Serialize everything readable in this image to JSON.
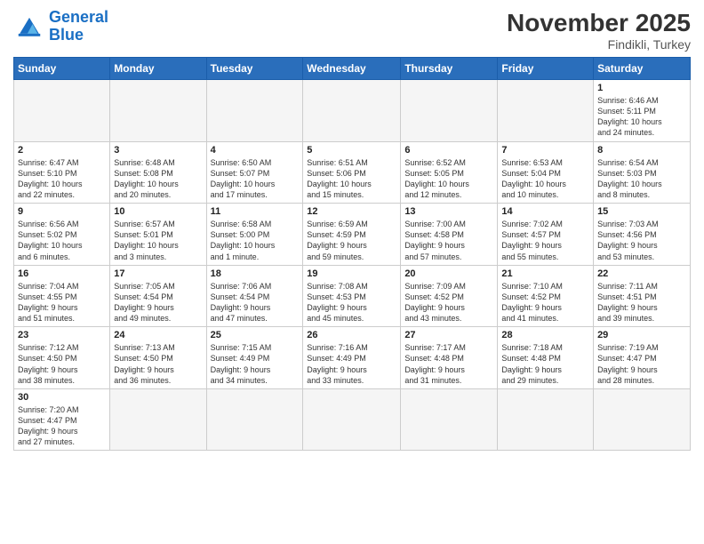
{
  "header": {
    "logo_general": "General",
    "logo_blue": "Blue",
    "month": "November 2025",
    "location": "Findikli, Turkey"
  },
  "days_of_week": [
    "Sunday",
    "Monday",
    "Tuesday",
    "Wednesday",
    "Thursday",
    "Friday",
    "Saturday"
  ],
  "weeks": [
    [
      {
        "num": "",
        "info": ""
      },
      {
        "num": "",
        "info": ""
      },
      {
        "num": "",
        "info": ""
      },
      {
        "num": "",
        "info": ""
      },
      {
        "num": "",
        "info": ""
      },
      {
        "num": "",
        "info": ""
      },
      {
        "num": "1",
        "info": "Sunrise: 6:46 AM\nSunset: 5:11 PM\nDaylight: 10 hours\nand 24 minutes."
      }
    ],
    [
      {
        "num": "2",
        "info": "Sunrise: 6:47 AM\nSunset: 5:10 PM\nDaylight: 10 hours\nand 22 minutes."
      },
      {
        "num": "3",
        "info": "Sunrise: 6:48 AM\nSunset: 5:08 PM\nDaylight: 10 hours\nand 20 minutes."
      },
      {
        "num": "4",
        "info": "Sunrise: 6:50 AM\nSunset: 5:07 PM\nDaylight: 10 hours\nand 17 minutes."
      },
      {
        "num": "5",
        "info": "Sunrise: 6:51 AM\nSunset: 5:06 PM\nDaylight: 10 hours\nand 15 minutes."
      },
      {
        "num": "6",
        "info": "Sunrise: 6:52 AM\nSunset: 5:05 PM\nDaylight: 10 hours\nand 12 minutes."
      },
      {
        "num": "7",
        "info": "Sunrise: 6:53 AM\nSunset: 5:04 PM\nDaylight: 10 hours\nand 10 minutes."
      },
      {
        "num": "8",
        "info": "Sunrise: 6:54 AM\nSunset: 5:03 PM\nDaylight: 10 hours\nand 8 minutes."
      }
    ],
    [
      {
        "num": "9",
        "info": "Sunrise: 6:56 AM\nSunset: 5:02 PM\nDaylight: 10 hours\nand 6 minutes."
      },
      {
        "num": "10",
        "info": "Sunrise: 6:57 AM\nSunset: 5:01 PM\nDaylight: 10 hours\nand 3 minutes."
      },
      {
        "num": "11",
        "info": "Sunrise: 6:58 AM\nSunset: 5:00 PM\nDaylight: 10 hours\nand 1 minute."
      },
      {
        "num": "12",
        "info": "Sunrise: 6:59 AM\nSunset: 4:59 PM\nDaylight: 9 hours\nand 59 minutes."
      },
      {
        "num": "13",
        "info": "Sunrise: 7:00 AM\nSunset: 4:58 PM\nDaylight: 9 hours\nand 57 minutes."
      },
      {
        "num": "14",
        "info": "Sunrise: 7:02 AM\nSunset: 4:57 PM\nDaylight: 9 hours\nand 55 minutes."
      },
      {
        "num": "15",
        "info": "Sunrise: 7:03 AM\nSunset: 4:56 PM\nDaylight: 9 hours\nand 53 minutes."
      }
    ],
    [
      {
        "num": "16",
        "info": "Sunrise: 7:04 AM\nSunset: 4:55 PM\nDaylight: 9 hours\nand 51 minutes."
      },
      {
        "num": "17",
        "info": "Sunrise: 7:05 AM\nSunset: 4:54 PM\nDaylight: 9 hours\nand 49 minutes."
      },
      {
        "num": "18",
        "info": "Sunrise: 7:06 AM\nSunset: 4:54 PM\nDaylight: 9 hours\nand 47 minutes."
      },
      {
        "num": "19",
        "info": "Sunrise: 7:08 AM\nSunset: 4:53 PM\nDaylight: 9 hours\nand 45 minutes."
      },
      {
        "num": "20",
        "info": "Sunrise: 7:09 AM\nSunset: 4:52 PM\nDaylight: 9 hours\nand 43 minutes."
      },
      {
        "num": "21",
        "info": "Sunrise: 7:10 AM\nSunset: 4:52 PM\nDaylight: 9 hours\nand 41 minutes."
      },
      {
        "num": "22",
        "info": "Sunrise: 7:11 AM\nSunset: 4:51 PM\nDaylight: 9 hours\nand 39 minutes."
      }
    ],
    [
      {
        "num": "23",
        "info": "Sunrise: 7:12 AM\nSunset: 4:50 PM\nDaylight: 9 hours\nand 38 minutes."
      },
      {
        "num": "24",
        "info": "Sunrise: 7:13 AM\nSunset: 4:50 PM\nDaylight: 9 hours\nand 36 minutes."
      },
      {
        "num": "25",
        "info": "Sunrise: 7:15 AM\nSunset: 4:49 PM\nDaylight: 9 hours\nand 34 minutes."
      },
      {
        "num": "26",
        "info": "Sunrise: 7:16 AM\nSunset: 4:49 PM\nDaylight: 9 hours\nand 33 minutes."
      },
      {
        "num": "27",
        "info": "Sunrise: 7:17 AM\nSunset: 4:48 PM\nDaylight: 9 hours\nand 31 minutes."
      },
      {
        "num": "28",
        "info": "Sunrise: 7:18 AM\nSunset: 4:48 PM\nDaylight: 9 hours\nand 29 minutes."
      },
      {
        "num": "29",
        "info": "Sunrise: 7:19 AM\nSunset: 4:47 PM\nDaylight: 9 hours\nand 28 minutes."
      }
    ],
    [
      {
        "num": "30",
        "info": "Sunrise: 7:20 AM\nSunset: 4:47 PM\nDaylight: 9 hours\nand 27 minutes."
      },
      {
        "num": "",
        "info": ""
      },
      {
        "num": "",
        "info": ""
      },
      {
        "num": "",
        "info": ""
      },
      {
        "num": "",
        "info": ""
      },
      {
        "num": "",
        "info": ""
      },
      {
        "num": "",
        "info": ""
      }
    ]
  ]
}
